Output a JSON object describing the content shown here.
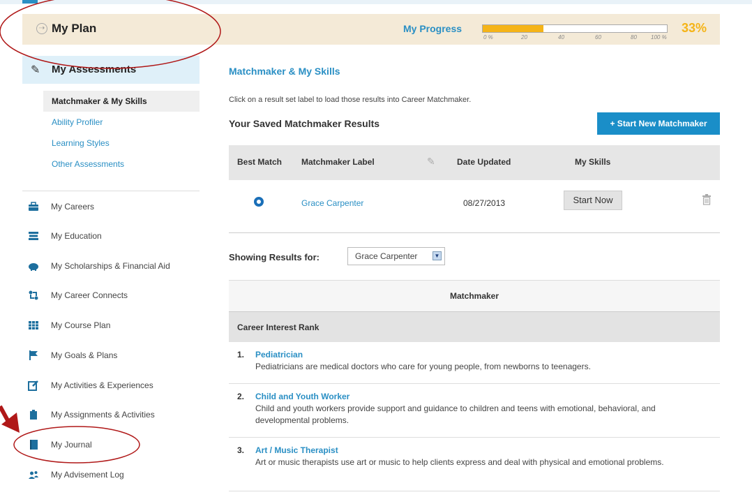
{
  "plan": {
    "title": "My Plan"
  },
  "progress": {
    "label": "My Progress",
    "fraction": 0.33,
    "percent_label": "33%",
    "ticks": [
      "0 %",
      "20",
      "40",
      "60",
      "80",
      "100 %"
    ],
    "fill_color": "#f5b418"
  },
  "sidebar": {
    "assessments_label": "My Assessments",
    "sub_items": [
      {
        "label": "Matchmaker & My Skills",
        "active": true
      },
      {
        "label": "Ability Profiler",
        "active": false
      },
      {
        "label": "Learning Styles",
        "active": false
      },
      {
        "label": "Other Assessments",
        "active": false
      }
    ],
    "nav_items": [
      {
        "label": "My Careers",
        "icon": "briefcase-icon"
      },
      {
        "label": "My Education",
        "icon": "books-icon"
      },
      {
        "label": "My Scholarships & Financial Aid",
        "icon": "piggy-bank-icon"
      },
      {
        "label": "My Career Connects",
        "icon": "connect-icon"
      },
      {
        "label": "My Course Plan",
        "icon": "grid-icon"
      },
      {
        "label": "My Goals & Plans",
        "icon": "flag-icon"
      },
      {
        "label": "My Activities & Experiences",
        "icon": "edit-icon"
      },
      {
        "label": "My Assignments & Activities",
        "icon": "clipboard-icon"
      },
      {
        "label": "My Journal",
        "icon": "journal-icon"
      },
      {
        "label": "My Advisement Log",
        "icon": "people-icon"
      }
    ]
  },
  "main": {
    "title": "Matchmaker & My Skills",
    "instructions": "Click on a result set label to load those results into Career Matchmaker.",
    "saved_heading": "Your Saved Matchmaker Results",
    "new_button": "+ Start New Matchmaker",
    "table": {
      "headers": [
        "Best Match",
        "Matchmaker Label",
        "Date Updated",
        "My Skills"
      ],
      "rows": [
        {
          "label": "Grace Carpenter",
          "date": "08/27/2013",
          "skills_button": "Start Now"
        }
      ]
    },
    "showing_label": "Showing Results for:",
    "showing_value": "Grace Carpenter",
    "matchmaker_heading": "Matchmaker",
    "rank_heading": "Career Interest Rank",
    "careers": [
      {
        "num": "1.",
        "title": "Pediatrician",
        "desc": "Pediatricians are medical doctors who care for young people, from newborns to teenagers."
      },
      {
        "num": "2.",
        "title": "Child and Youth Worker",
        "desc": "Child and youth workers provide support and guidance to children and teens with emotional, behavioral, and developmental problems."
      },
      {
        "num": "3.",
        "title": "Art / Music Therapist",
        "desc": "Art or music therapists use art or music to help clients express and deal with physical and emotional problems."
      }
    ]
  },
  "colors": {
    "accent": "#2a8fc4",
    "primary_button": "#1a8ec8",
    "annotation": "#b01818"
  }
}
